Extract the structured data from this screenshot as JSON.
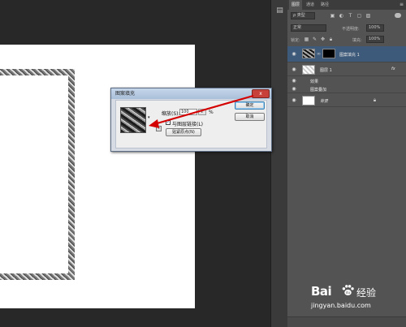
{
  "panel": {
    "tabs": [
      "图层",
      "通道",
      "路径"
    ],
    "filter_kind": "类型",
    "blend_mode": "正常",
    "opacity_label": "不透明度:",
    "opacity_value": "100%",
    "lock_label": "锁定:",
    "fill_label": "填充:",
    "fill_value": "100%",
    "layers": [
      {
        "name": "图案填充 1",
        "selected": true
      },
      {
        "name": "图层 1",
        "fx": "fx"
      },
      {
        "name": "效果",
        "sub": true
      },
      {
        "name": "图案叠加",
        "sub": true
      },
      {
        "name": "背景",
        "locked": true
      }
    ]
  },
  "dialog": {
    "title": "图案填充",
    "close_label": "x",
    "scale_label": "缩放(S):",
    "scale_value": "100",
    "percent": "%",
    "ok_label": "确定",
    "cancel_label": "取消",
    "link_label": "与图层链接(L)",
    "snap_label": "贴紧原点(N)"
  },
  "watermark": {
    "brand": "Bai",
    "brand_tail": "du",
    "jingyan": "经验",
    "url": "jingyan.baidu.com"
  },
  "colors": {
    "accent_selected": "#3e5a7a",
    "arrow": "#d40000"
  }
}
